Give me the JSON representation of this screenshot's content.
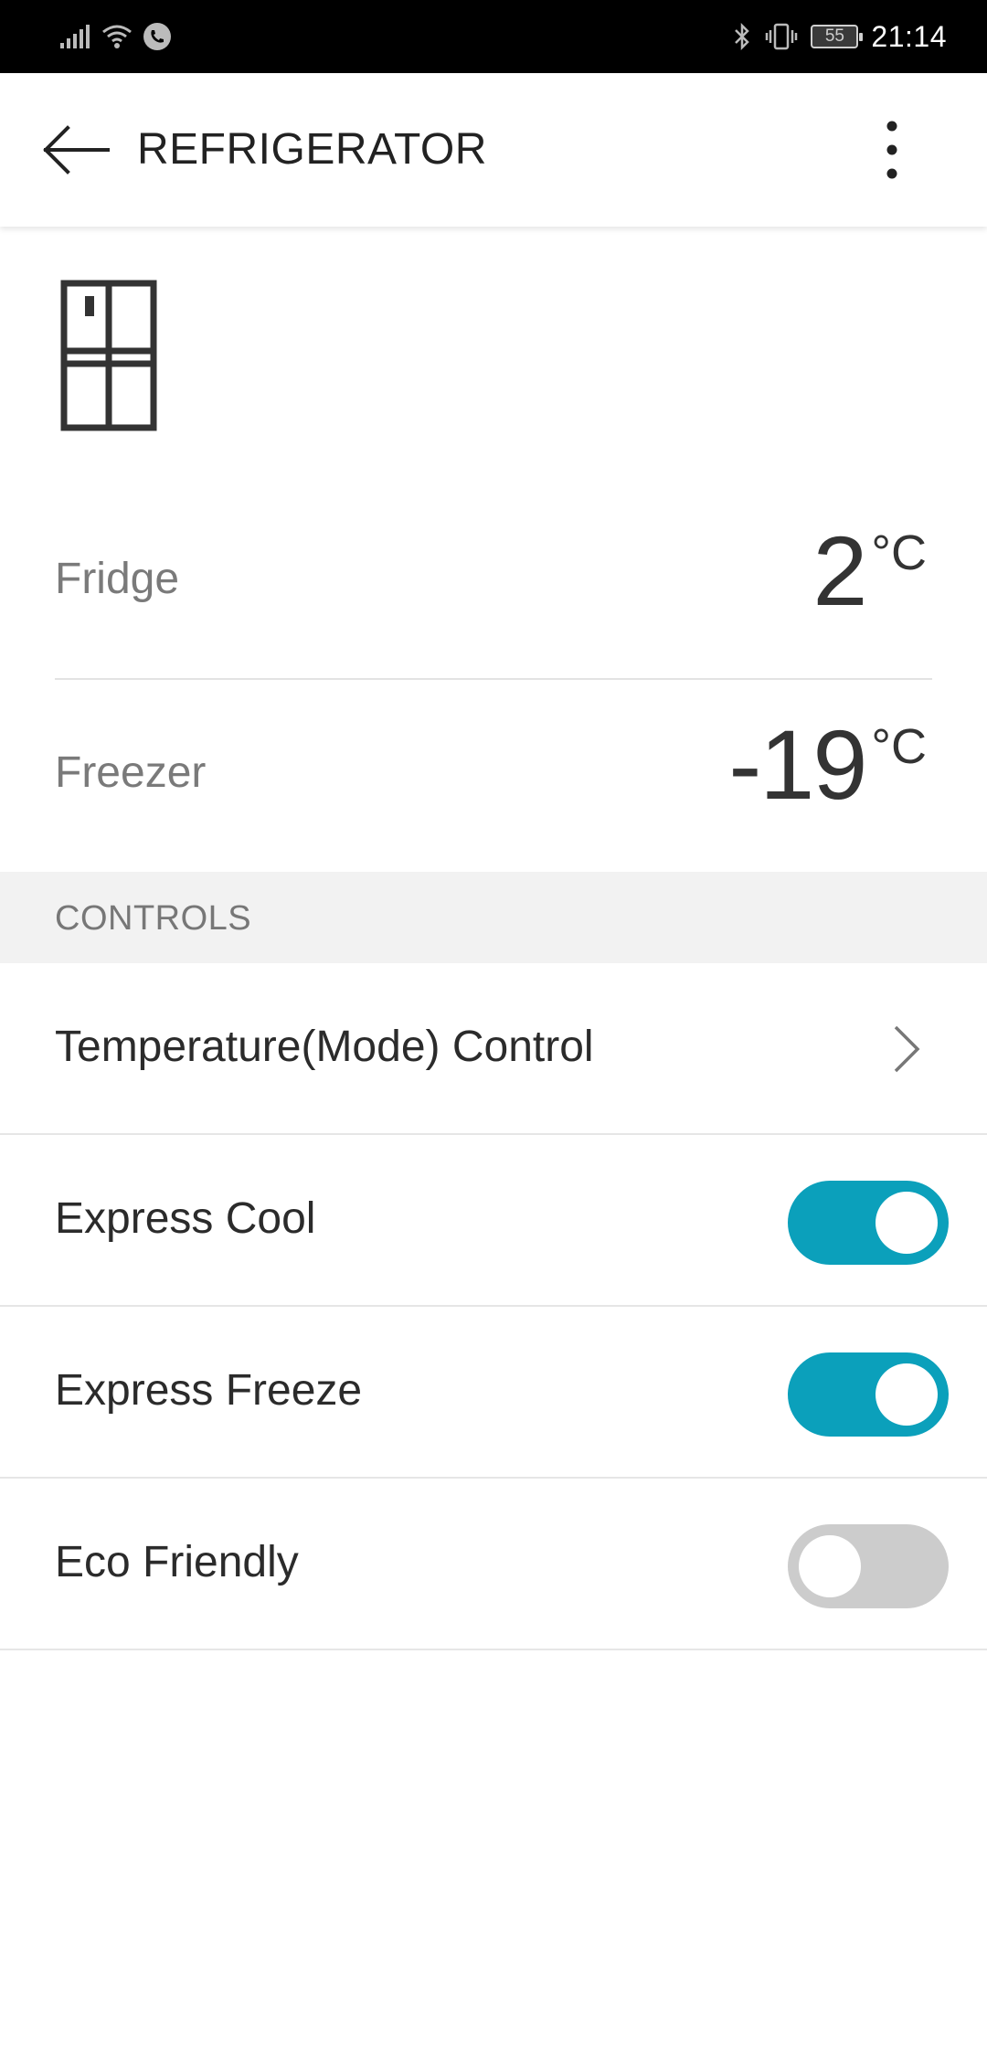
{
  "status_bar": {
    "battery": "55",
    "time": "21:14"
  },
  "app_bar": {
    "title": "REFRIGERATOR"
  },
  "temperatures": [
    {
      "label": "Fridge",
      "value": "2",
      "unit": "°C"
    },
    {
      "label": "Freezer",
      "value": "-19",
      "unit": "°C"
    }
  ],
  "controls": {
    "section_title": "CONTROLS",
    "items": [
      {
        "label": "Temperature(Mode) Control",
        "type": "link"
      },
      {
        "label": "Express Cool",
        "type": "toggle",
        "on": true
      },
      {
        "label": "Express Freeze",
        "type": "toggle",
        "on": true
      },
      {
        "label": "Eco Friendly",
        "type": "toggle",
        "on": false
      }
    ]
  },
  "colors": {
    "accent": "#0ba0bb",
    "toggle_off": "#cccccc",
    "status_bar": "#000000"
  },
  "icons": [
    "signal-icon",
    "wifi-icon",
    "call-icon",
    "bluetooth-icon",
    "vibrate-icon",
    "battery-icon",
    "back-arrow-icon",
    "more-vert-icon",
    "refrigerator-icon",
    "chevron-right-icon"
  ]
}
